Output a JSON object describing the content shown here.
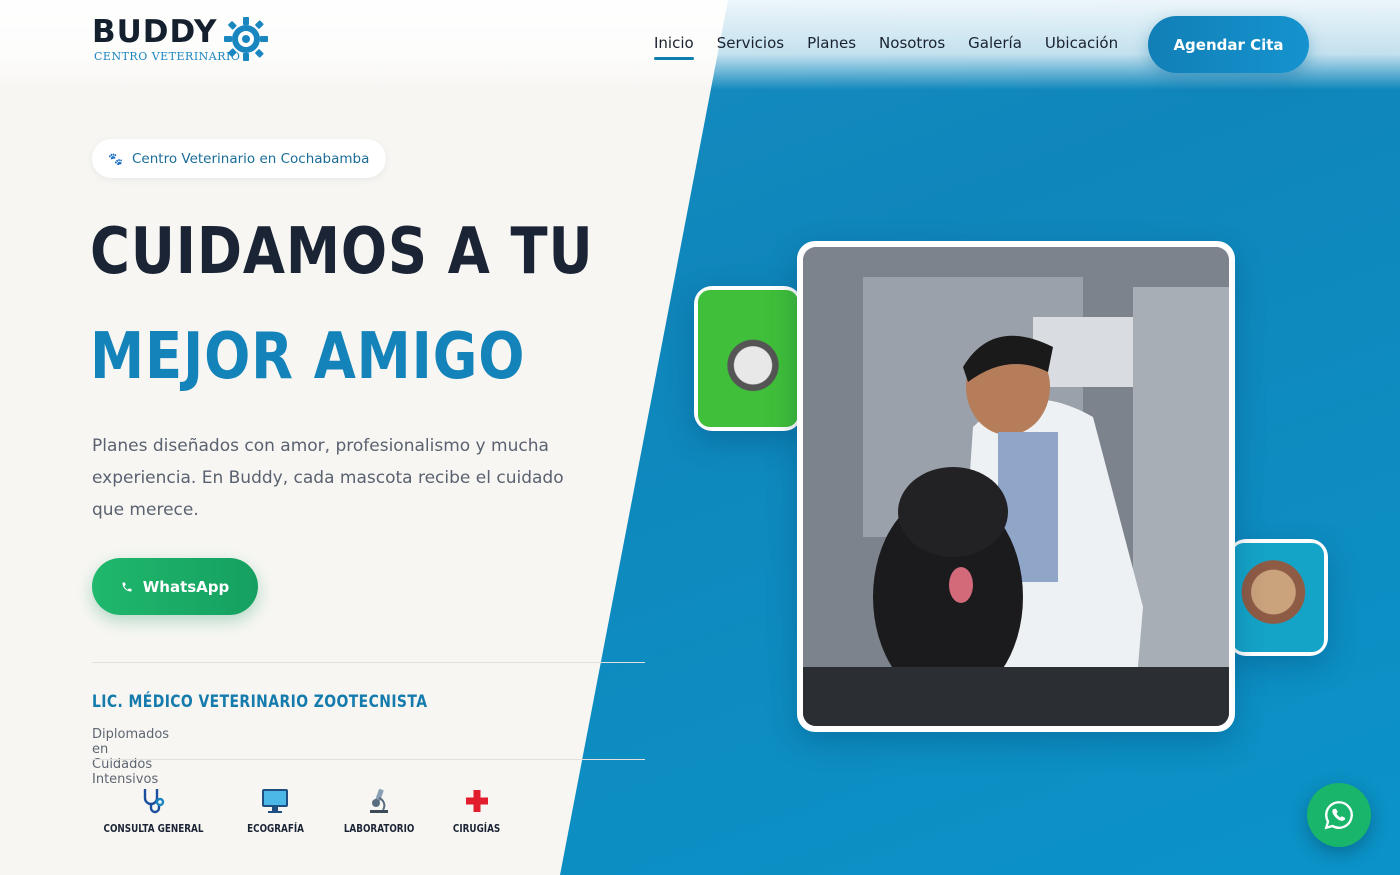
{
  "brand": {
    "name": "BUDDY",
    "tagline": "CENTRO VETERINARIO"
  },
  "nav": {
    "items": [
      {
        "label": "Inicio",
        "active": true
      },
      {
        "label": "Servicios",
        "active": false
      },
      {
        "label": "Planes",
        "active": false
      },
      {
        "label": "Nosotros",
        "active": false
      },
      {
        "label": "Galería",
        "active": false
      },
      {
        "label": "Ubicación",
        "active": false
      }
    ],
    "cta_label": "Agendar Cita"
  },
  "hero": {
    "badge_icon": "paw-icon",
    "badge_text": "Centro Veterinario en Cochabamba",
    "title_line1": "CUIDAMOS A TU",
    "title_line2": "MEJOR AMIGO",
    "lead": "Planes diseñados con amor, profesionalismo y mucha experiencia. En Buddy, cada mascota recibe el cuidado que merece.",
    "whatsapp_label": "WhatsApp",
    "credential_title": "LIC. MÉDICO VETERINARIO ZOOTECNISTA",
    "credential_sub": "Diplomados en Cuidados Intensivos"
  },
  "services": [
    {
      "label": "CONSULTA GENERAL",
      "icon": "stethoscope-icon"
    },
    {
      "label": "ECOGRAFÍA",
      "icon": "monitor-icon"
    },
    {
      "label": "LABORATORIO",
      "icon": "microscope-icon"
    },
    {
      "label": "CIRUGÍAS",
      "icon": "cross-icon"
    }
  ],
  "colors": {
    "accent": "#1383b9",
    "dark": "#1b2435",
    "whatsapp": "#1fb86c",
    "panel": "#0f86bb"
  }
}
